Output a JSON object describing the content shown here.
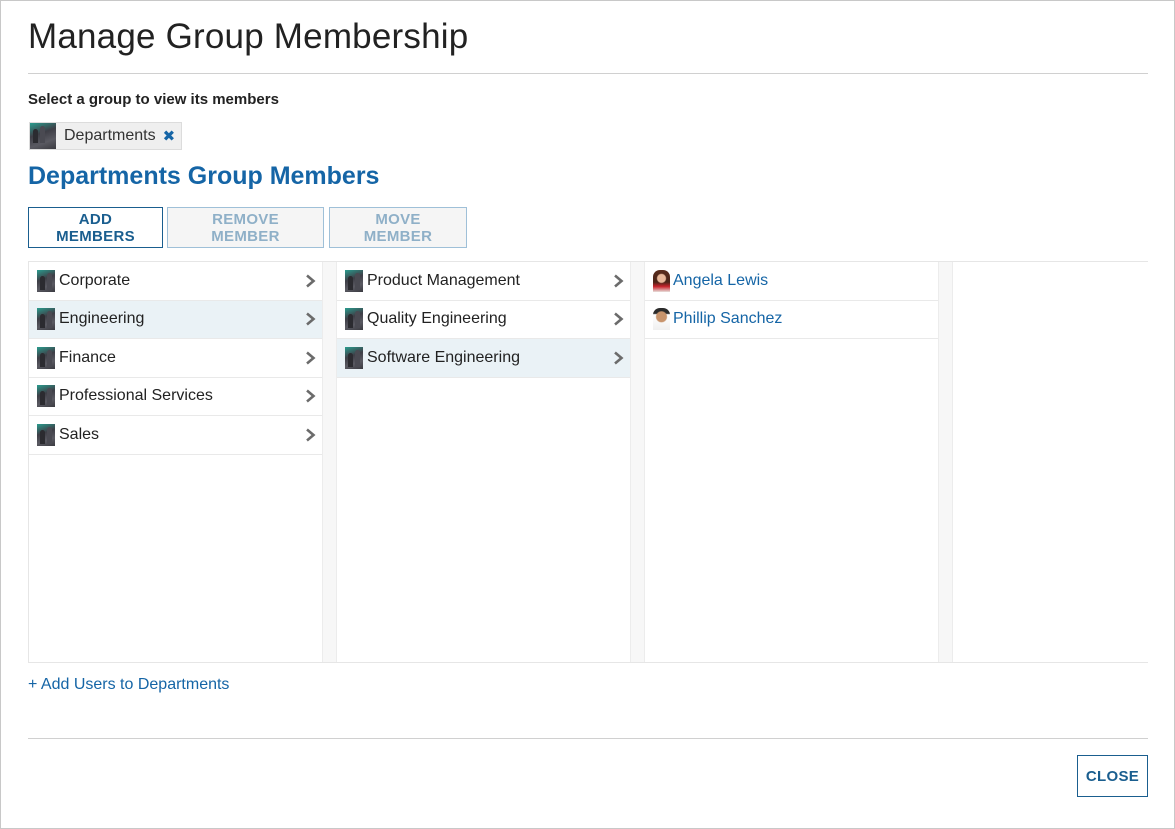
{
  "dialog": {
    "title": "Manage Group Membership",
    "select_label": "Select a group to view its members",
    "selected_group": {
      "label": "Departments",
      "icon": "group-icon",
      "remove_icon": "close-icon"
    },
    "section_title": "Departments Group Members"
  },
  "toolbar": {
    "add_members": "ADD MEMBERS",
    "remove_member": "REMOVE MEMBER",
    "move_member": "MOVE MEMBER",
    "remove_member_disabled": true,
    "move_member_disabled": true
  },
  "columns": [
    {
      "items": [
        {
          "label": "Corporate",
          "selected": false,
          "has_children": true
        },
        {
          "label": "Engineering",
          "selected": true,
          "has_children": true
        },
        {
          "label": "Finance",
          "selected": false,
          "has_children": true
        },
        {
          "label": "Professional Services",
          "selected": false,
          "has_children": true
        },
        {
          "label": "Sales",
          "selected": false,
          "has_children": true
        }
      ]
    },
    {
      "items": [
        {
          "label": "Product Management",
          "selected": false,
          "has_children": true
        },
        {
          "label": "Quality Engineering",
          "selected": false,
          "has_children": true
        },
        {
          "label": "Software Engineering",
          "selected": true,
          "has_children": true
        }
      ]
    },
    {
      "members": [
        {
          "name": "Angela Lewis",
          "avatar": "user-avatar-icon"
        },
        {
          "name": "Phillip Sanchez",
          "avatar": "user-avatar-icon"
        }
      ]
    },
    {
      "items": []
    }
  ],
  "footer": {
    "add_users_link": "+ Add Users to Departments",
    "close": "CLOSE"
  },
  "colors": {
    "accent": "#1565a6",
    "button_border": "#1a5e8f",
    "disabled_text": "#8fb0c8",
    "selected_row": "#eaf2f6"
  }
}
